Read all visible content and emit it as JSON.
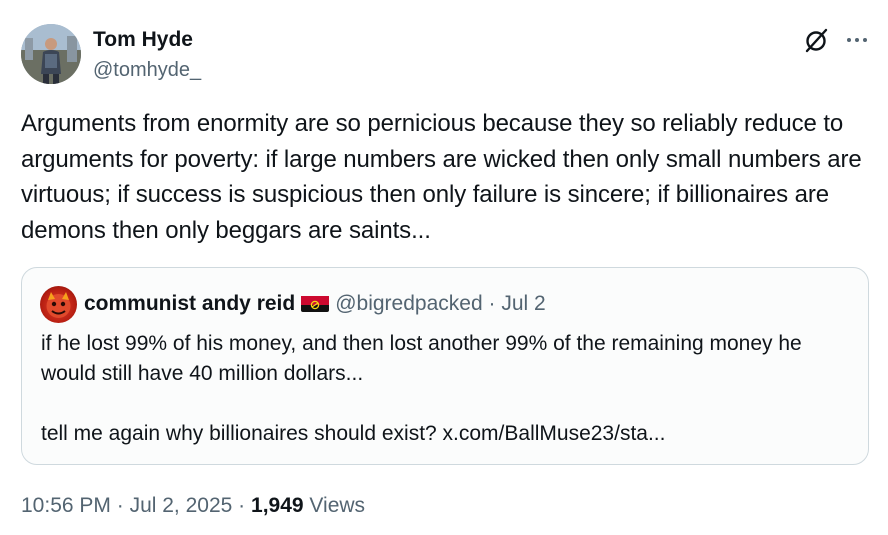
{
  "author": {
    "name": "Tom Hyde",
    "handle": "@tomhyde_"
  },
  "tweet": {
    "text": "Arguments from enormity are so pernicious because they so reliably reduce to arguments for poverty: if large numbers are wicked then only small numbers are virtuous; if success is suspicious then only failure is sincere; if billionaires are demons then only beggars are saints..."
  },
  "quote": {
    "name": "communist andy reid",
    "flag_icon": "angola-flag-icon",
    "handle": "@bigredpacked",
    "separator": "·",
    "date": "Jul 2",
    "line1": "if he lost 99% of his money, and then lost another 99% of the remaining money he would still have 40 million dollars...",
    "line2": "tell me again why billionaires should exist? x.com/BallMuse23/sta..."
  },
  "meta": {
    "time": "10:56 PM",
    "separator": "·",
    "date": "Jul 2, 2025",
    "views_count": "1,949",
    "views_label": "Views"
  },
  "colors": {
    "text_primary": "#0f1419",
    "text_secondary": "#536471",
    "border": "#cfd9de"
  },
  "icons": {
    "action_1": "grok-icon",
    "action_2": "more-icon"
  }
}
